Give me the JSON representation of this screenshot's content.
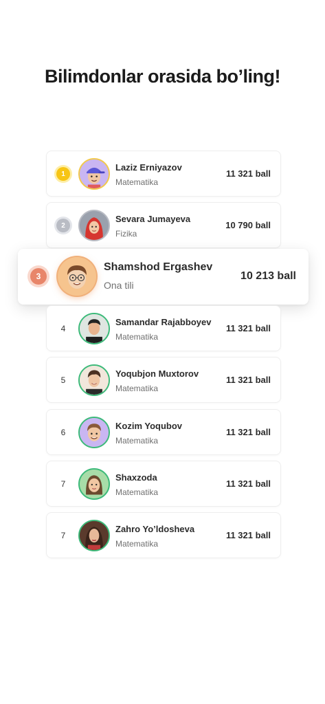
{
  "headline": "Bilimdonlar orasida bo’ling!",
  "leaderboard": [
    {
      "rank": "1",
      "name": "Laziz Erniyazov",
      "subject": "Matematika",
      "score": "11 321 ball",
      "avatar_icon": "memoji-boy-cap-avatar"
    },
    {
      "rank": "2",
      "name": "Sevara Jumayeva",
      "subject": "Fizika",
      "score": "10 790 ball",
      "avatar_icon": "memoji-girl-hijab-avatar"
    },
    {
      "rank": "3",
      "name": "Shamshod Ergashev",
      "subject": "Ona tili",
      "score": "10 213 ball",
      "avatar_icon": "memoji-boy-glasses-avatar"
    },
    {
      "rank": "4",
      "name": "Samandar Rajabboyev",
      "subject": "Matematika",
      "score": "11 321 ball",
      "avatar_icon": "photo-avatar"
    },
    {
      "rank": "5",
      "name": "Yoqubjon Muxtorov",
      "subject": "Matematika",
      "score": "11 321 ball",
      "avatar_icon": "photo-avatar"
    },
    {
      "rank": "6",
      "name": "Kozim Yoqubov",
      "subject": "Matematika",
      "score": "11 321 ball",
      "avatar_icon": "memoji-avatar"
    },
    {
      "rank": "7",
      "name": "Shaxzoda",
      "subject": "Matematika",
      "score": "11 321 ball",
      "avatar_icon": "memoji-girl-avatar"
    },
    {
      "rank": "7",
      "name": "Zahro Yo’ldosheva",
      "subject": "Matematika",
      "score": "11 321 ball",
      "avatar_icon": "photo-avatar"
    }
  ],
  "colors": {
    "gold": "#f7c514",
    "silver": "#b9bcc4",
    "bronze": "#e8866a",
    "avatar_ring": "#3dba7a"
  }
}
